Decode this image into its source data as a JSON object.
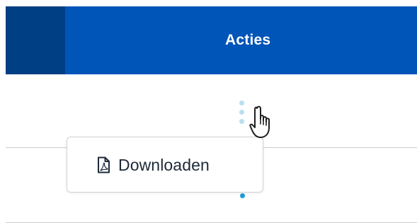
{
  "table": {
    "header": {
      "actions_label": "Acties"
    }
  },
  "row_actions": {
    "trigger_icon": "kebab-dots-icon"
  },
  "dropdown": {
    "items": [
      {
        "label": "Downloaden",
        "icon": "pdf-file-icon"
      }
    ]
  },
  "colors": {
    "header_blue": "#0055b8",
    "header_dark": "#003f84",
    "dot_accent": "#1e9bd7"
  }
}
